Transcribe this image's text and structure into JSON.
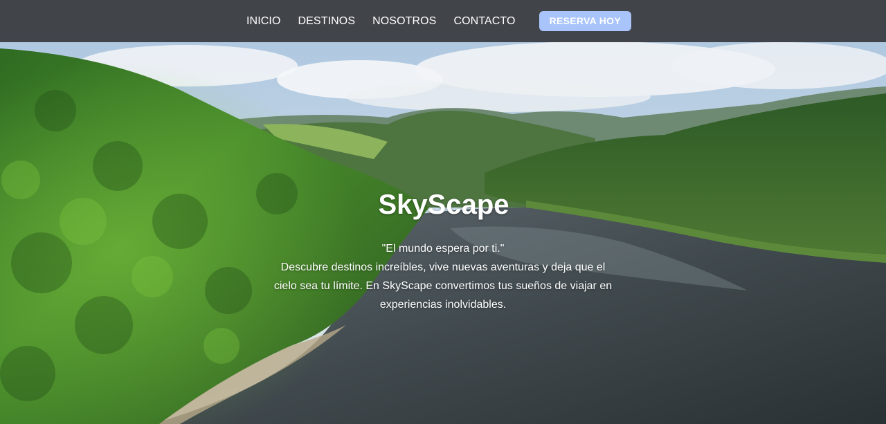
{
  "nav": {
    "items": [
      {
        "label": "INICIO"
      },
      {
        "label": "DESTINOS"
      },
      {
        "label": "NOSOTROS"
      },
      {
        "label": "CONTACTO"
      }
    ],
    "cta_label": "RESERVA HOY"
  },
  "hero": {
    "title": "SkyScape",
    "quote": "\"El mundo espera por ti.\"",
    "description": "Descubre destinos increíbles, vive nuevas aventuras y deja que el cielo sea tu límite. En SkyScape convertimos tus sueños de viajar en experiencias inolvidables."
  },
  "colors": {
    "nav_background": "#3a3c40",
    "cta_background": "#a9c4fb",
    "text": "#ffffff"
  }
}
